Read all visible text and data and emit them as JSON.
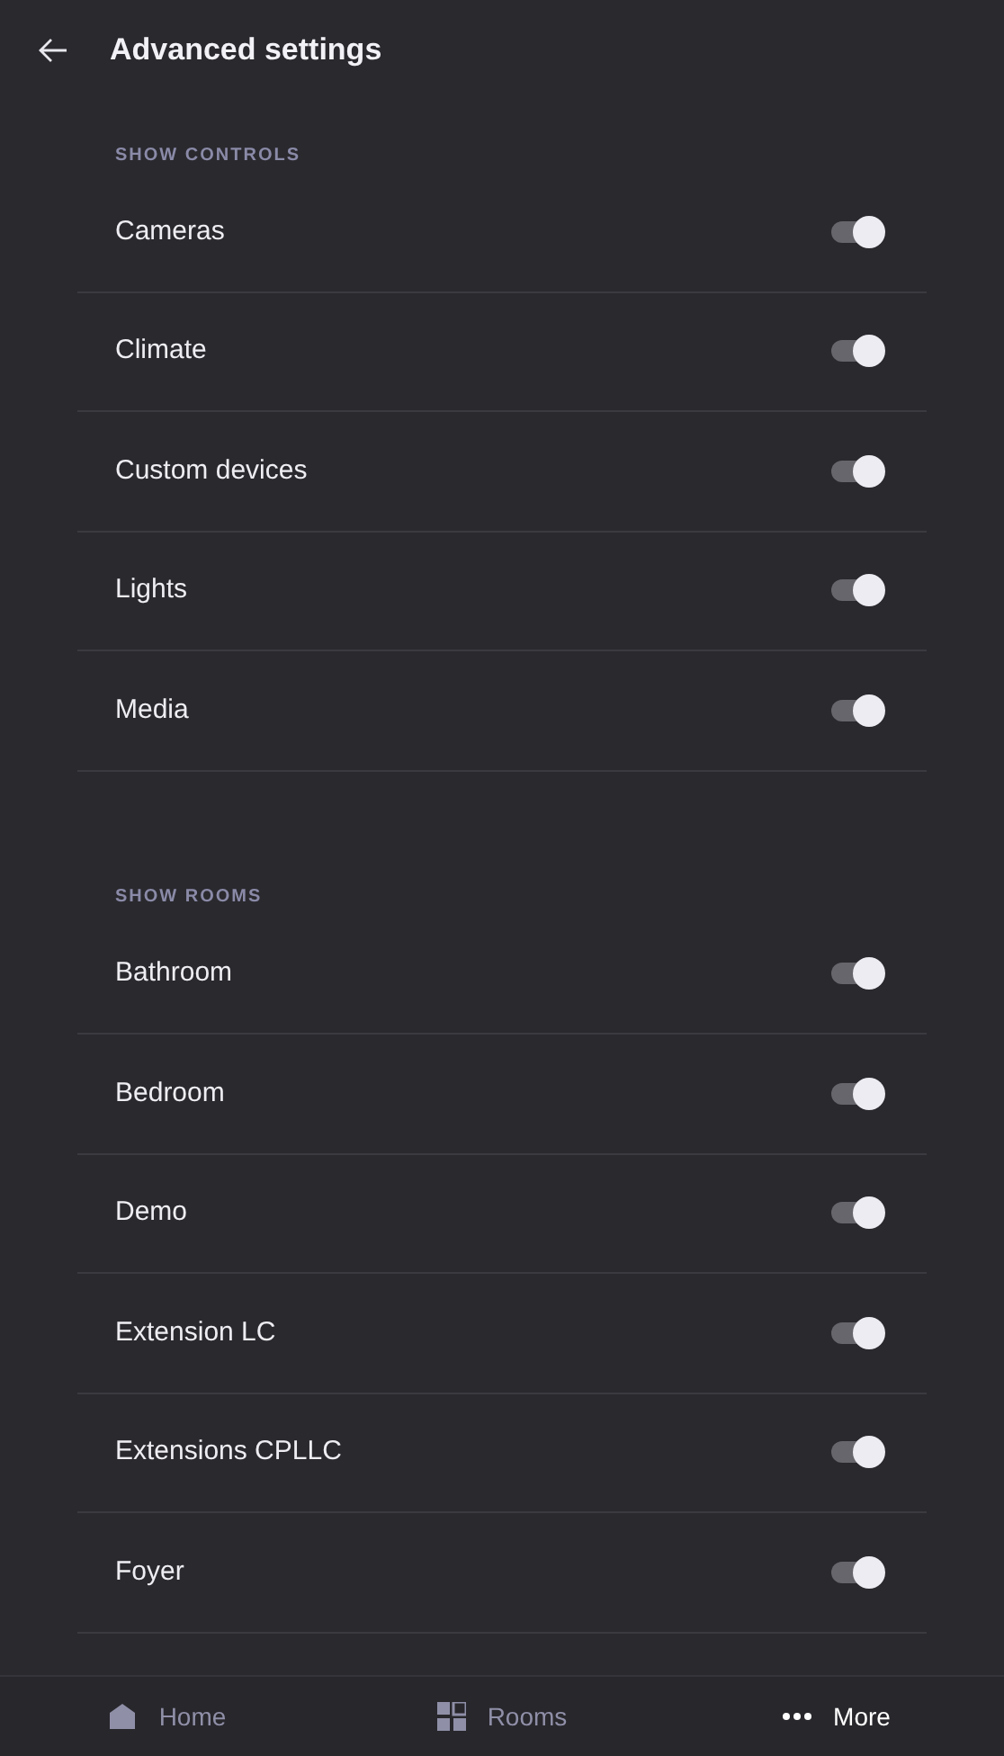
{
  "header": {
    "title": "Advanced settings"
  },
  "sections": [
    {
      "label": "SHOW CONTROLS",
      "items": [
        {
          "name": "Cameras",
          "on": true
        },
        {
          "name": "Climate",
          "on": true
        },
        {
          "name": "Custom devices",
          "on": true
        },
        {
          "name": "Lights",
          "on": true
        },
        {
          "name": "Media",
          "on": true
        }
      ]
    },
    {
      "label": "SHOW ROOMS",
      "items": [
        {
          "name": "Bathroom",
          "on": true
        },
        {
          "name": "Bedroom",
          "on": true
        },
        {
          "name": "Demo",
          "on": true
        },
        {
          "name": "Extension LC",
          "on": true
        },
        {
          "name": "Extensions CPLLC",
          "on": true
        },
        {
          "name": "Foyer",
          "on": true
        }
      ]
    }
  ],
  "nav": [
    {
      "kind": "home",
      "label": "Home",
      "selected": false
    },
    {
      "kind": "rooms",
      "label": "Rooms",
      "selected": false
    },
    {
      "kind": "more",
      "label": "More",
      "selected": true
    }
  ]
}
